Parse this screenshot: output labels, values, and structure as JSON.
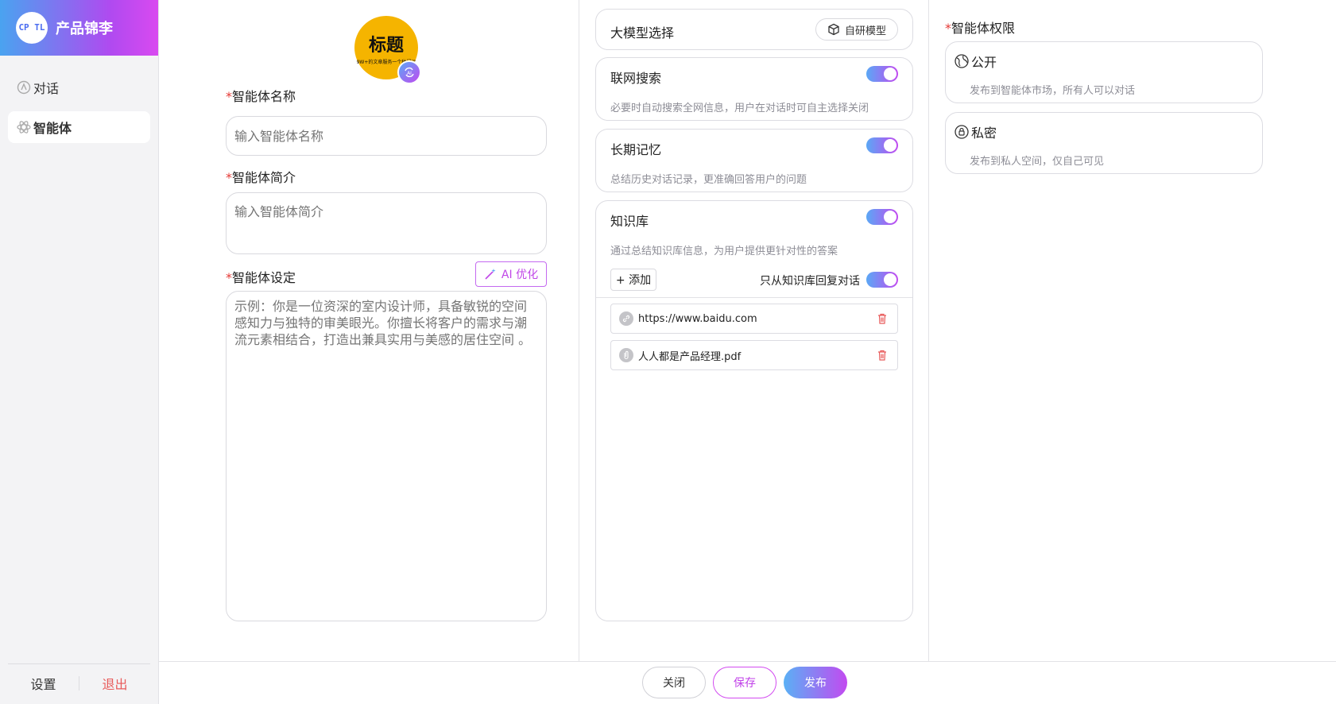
{
  "app": {
    "logo_mark": "CP TL",
    "name": "产品锦李"
  },
  "sidebar": {
    "items": [
      {
        "label": "对话",
        "icon": "chat-icon"
      },
      {
        "label": "智能体",
        "icon": "atom-icon"
      }
    ],
    "settings_label": "设置",
    "logout_label": "退出"
  },
  "avatar": {
    "title": "标题",
    "subtitle": "9W+的文章服务一个种门运"
  },
  "form": {
    "name_label": "智能体名称",
    "name_placeholder": "输入智能体名称",
    "intro_label": "智能体简介",
    "intro_placeholder": "输入智能体简介",
    "setting_label": "智能体设定",
    "setting_placeholder": "示例：你是一位资深的室内设计师，具备敏锐的空间感知力与独特的审美眼光。你擅长将客户的需求与潮流元素相结合，打造出兼具实用与美感的居住空间 。",
    "ai_optimize_label": "AI 优化",
    "required_mark": "*"
  },
  "config": {
    "model": {
      "title": "大模型选择",
      "button_label": "自研模型"
    },
    "web_search": {
      "title": "联网搜索",
      "desc": "必要时自动搜索全网信息，用户在对话时可自主选择关闭",
      "enabled": true
    },
    "memory": {
      "title": "长期记忆",
      "desc": "总结历史对话记录，更准确回答用户的问题",
      "enabled": true
    },
    "knowledge": {
      "title": "知识库",
      "desc": "通过总结知识库信息，为用户提供更针对性的答案",
      "enabled": true,
      "add_label": "+ 添加",
      "only_kb_label": "只从知识库回复对话",
      "only_kb_enabled": true,
      "items": [
        {
          "name": "https://www.baidu.com",
          "icon": "link-icon"
        },
        {
          "name": "人人都是产品经理.pdf",
          "icon": "paperclip-icon"
        }
      ]
    }
  },
  "permissions": {
    "label": "智能体权限",
    "options": [
      {
        "title": "公开",
        "desc": "发布到智能体市场，所有人可以对话",
        "icon": "globe-icon"
      },
      {
        "title": "私密",
        "desc": "发布到私人空间，仅自己可见",
        "icon": "lock-icon"
      }
    ]
  },
  "footer": {
    "close_label": "关闭",
    "save_label": "保存",
    "publish_label": "发布"
  },
  "colors": {
    "accent_start": "#5aa8f5",
    "accent_end": "#c24af0",
    "danger": "#e85a5a"
  }
}
